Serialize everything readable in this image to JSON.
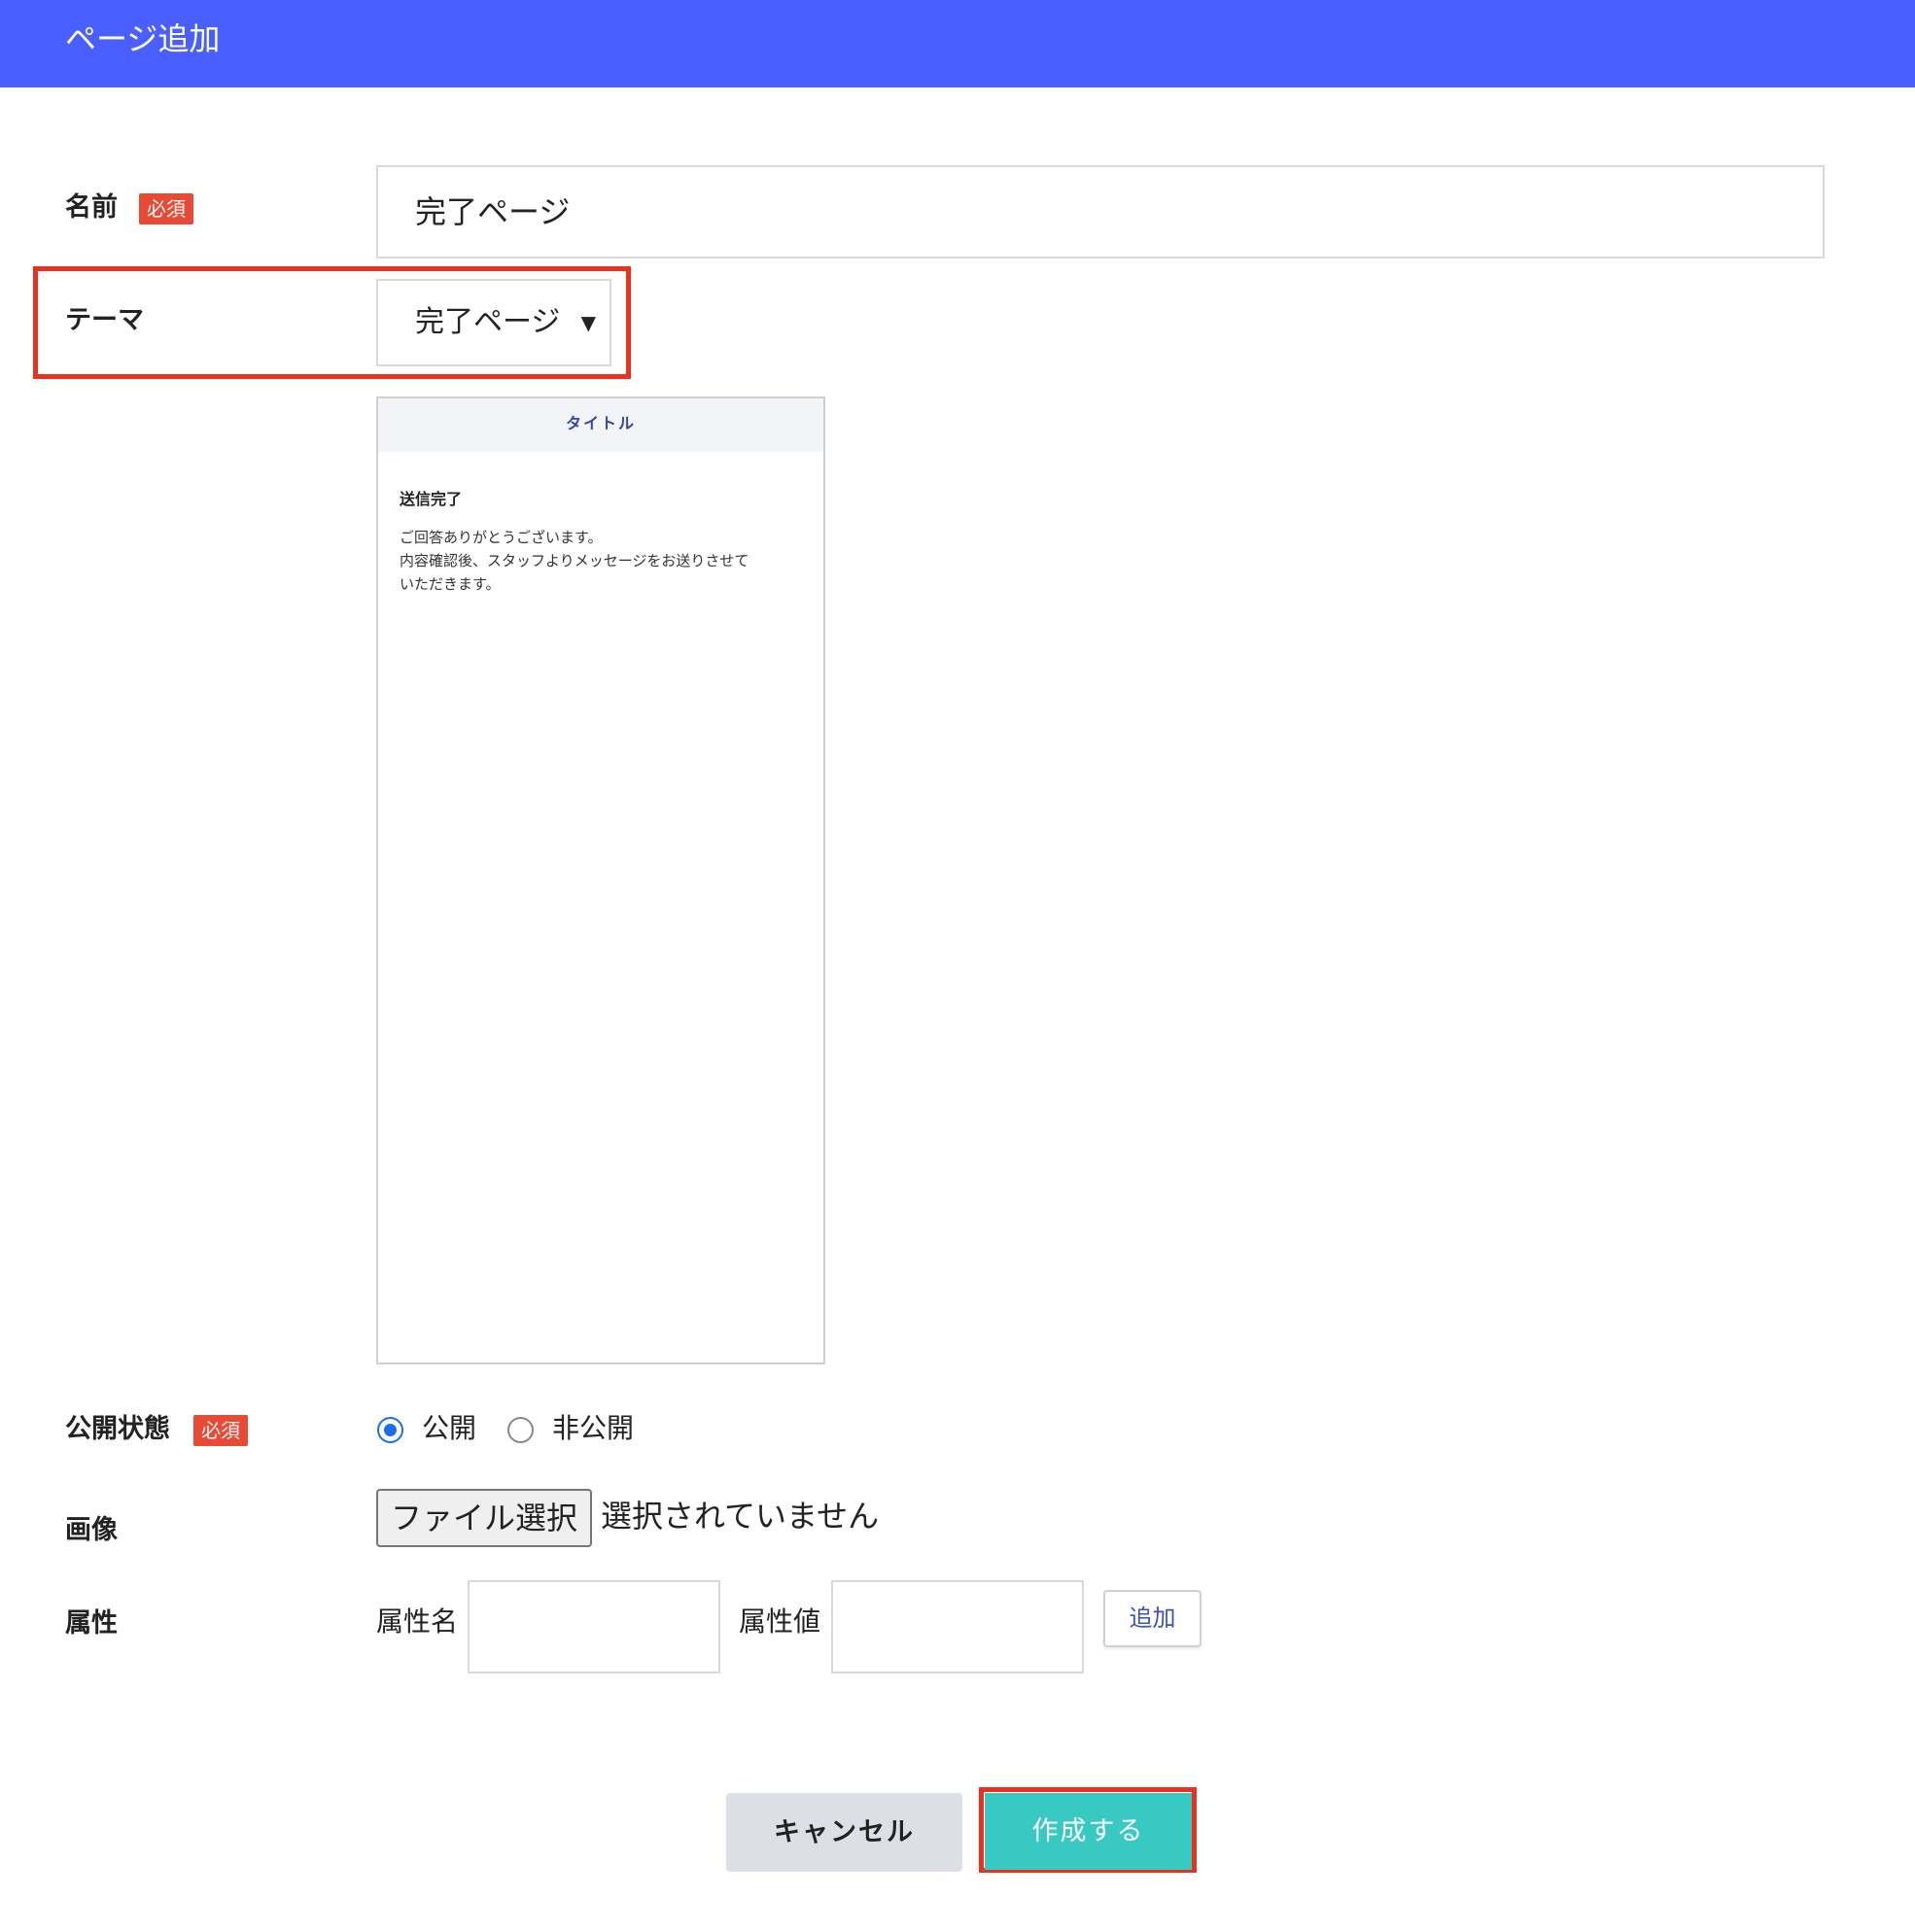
{
  "header": {
    "title": "ページ追加"
  },
  "required_badge": "必須",
  "name_field": {
    "label": "名前",
    "value": "完了ページ"
  },
  "theme_field": {
    "label": "テーマ",
    "selected": "完了ページ",
    "arrow": "▼"
  },
  "preview": {
    "title": "タイトル",
    "heading": "送信完了",
    "lines": [
      "ご回答ありがとうございます。",
      "内容確認後、スタッフよりメッセージをお送りさせて",
      "いただきます。"
    ]
  },
  "visibility_field": {
    "label": "公開状態",
    "options": [
      {
        "label": "公開",
        "checked": true
      },
      {
        "label": "非公開",
        "checked": false
      }
    ]
  },
  "image_field": {
    "label": "画像",
    "button_label": "ファイル選択",
    "status": "選択されていません"
  },
  "attribute_field": {
    "label": "属性",
    "name_label": "属性名",
    "name_value": "",
    "value_label": "属性値",
    "value_value": "",
    "add_label": "追加"
  },
  "actions": {
    "cancel_label": "キャンセル",
    "create_label": "作成する"
  },
  "colors": {
    "header": "#4a5fff",
    "badge": "#ea4a34",
    "highlight": "#e8321e",
    "create_button": "#38c9c3",
    "cancel_button": "#dcdfe5",
    "radio_checked": "#1a6fe8"
  }
}
